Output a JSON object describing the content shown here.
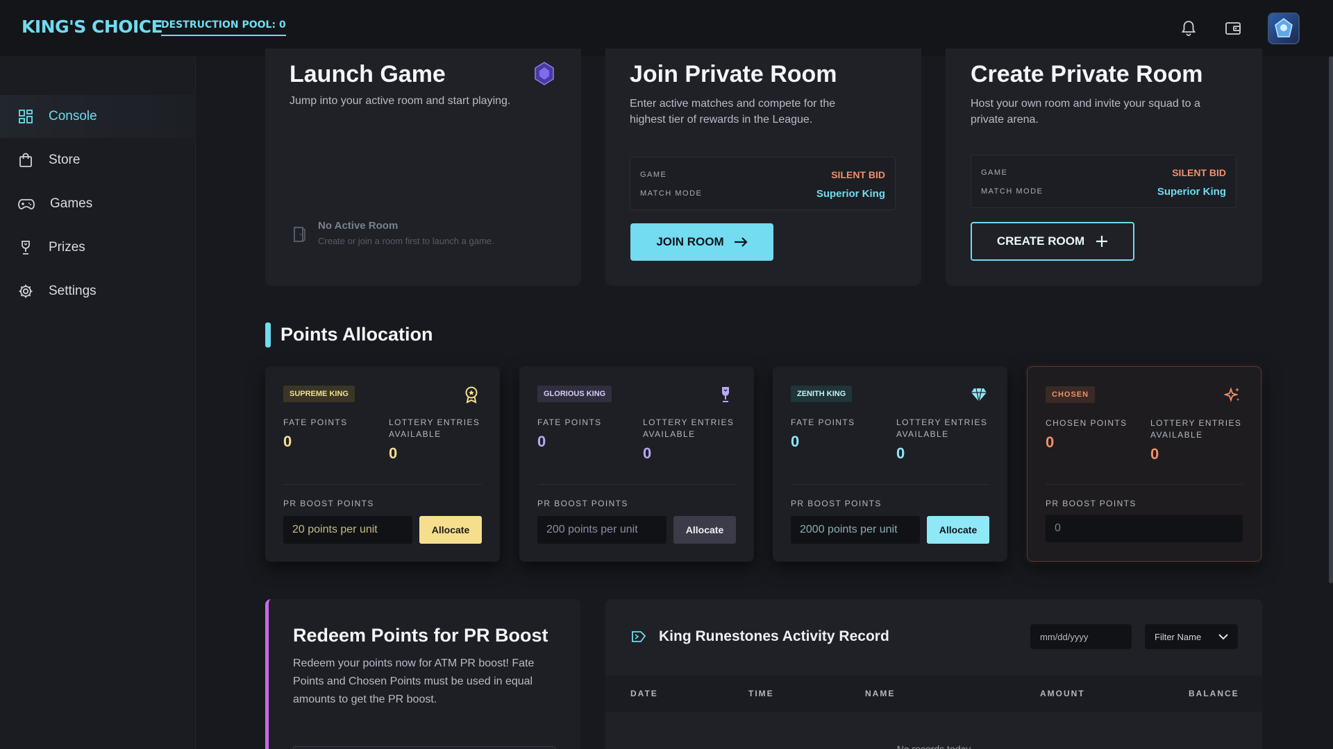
{
  "header": {
    "logo": "KING'S CHOICE",
    "pool": "DESTRUCTION POOL: 0",
    "icons": [
      "bell-icon",
      "wallet-icon",
      "avatar"
    ]
  },
  "sidebar": {
    "items": [
      {
        "label": "Console",
        "icon": "dashboard-icon",
        "active": true
      },
      {
        "label": "Store",
        "icon": "bag-icon"
      },
      {
        "label": "Games",
        "icon": "gamepad-icon"
      },
      {
        "label": "Prizes",
        "icon": "trophy-icon"
      },
      {
        "label": "Settings",
        "icon": "gear-icon"
      }
    ]
  },
  "launch": {
    "title": "Launch Game",
    "subtitle": "Jump into your active room and start playing.",
    "empty_title": "No Active Room",
    "empty_sub": "Create or join a room first to launch a game."
  },
  "join": {
    "title": "Join Private Room",
    "subtitle_1": "Enter active matches and compete for the",
    "subtitle_2": "highest tier of rewards in the League.",
    "game_label": "GAME",
    "game_value": "SILENT BID",
    "mode_label": "MATCH MODE",
    "mode_value": "Superior King",
    "button": "JOIN ROOM"
  },
  "create": {
    "title": "Create Private Room",
    "subtitle_1": "Host your own room and invite your squad to a",
    "subtitle_2": "private arena.",
    "game_label": "GAME",
    "game_value": "SILENT BID",
    "mode_label": "MATCH MODE",
    "mode_value": "Superior King",
    "button": "CREATE ROOM"
  },
  "points": {
    "title": "Points Allocation",
    "cards": [
      {
        "badge": "SUPREME KING",
        "label_1": "FATE POINTS",
        "value_1": "0",
        "label_2a": "LOTTERY ENTRIES",
        "label_2b": "AVAILABLE",
        "value_2": "0",
        "boost_label": "PR BOOST POINTS",
        "placeholder": "20 points per unit",
        "button": "Allocate",
        "accent": "#f5df8e"
      },
      {
        "badge": "GLORIOUS KING",
        "label_1": "FATE POINTS",
        "value_1": "0",
        "label_2a": "LOTTERY ENTRIES",
        "label_2b": "AVAILABLE",
        "value_2": "0",
        "boost_label": "PR BOOST POINTS",
        "placeholder": "200 points per unit",
        "button": "Allocate",
        "accent": "#b9a8f3"
      },
      {
        "badge": "ZENITH KING",
        "label_1": "FATE POINTS",
        "value_1": "0",
        "label_2a": "LOTTERY ENTRIES",
        "label_2b": "AVAILABLE",
        "value_2": "0",
        "boost_label": "PR BOOST POINTS",
        "placeholder": "2000 points per unit",
        "button": "Allocate",
        "accent": "#8fe8f6"
      },
      {
        "badge": "CHOSEN",
        "label_1": "CHOSEN POINTS",
        "value_1": "0",
        "label_2a": "LOTTERY ENTRIES",
        "label_2b": "AVAILABLE",
        "value_2": "0",
        "boost_label": "PR BOOST POINTS",
        "input_value": "0",
        "accent": "#f0906a"
      }
    ]
  },
  "redeem": {
    "title": "Redeem Points for PR Boost",
    "line_1": "Redeem your points now for ATM PR boost! Fate",
    "line_2": "Points and Chosen Points must be used in equal",
    "line_3": "amounts to get the PR boost."
  },
  "record": {
    "title": "King Runestones Activity Record",
    "date_placeholder": "mm/dd/yyyy",
    "filter": "Filter Name",
    "columns": [
      "DATE",
      "TIME",
      "NAME",
      "AMOUNT",
      "BALANCE"
    ],
    "empty": "No records today"
  }
}
